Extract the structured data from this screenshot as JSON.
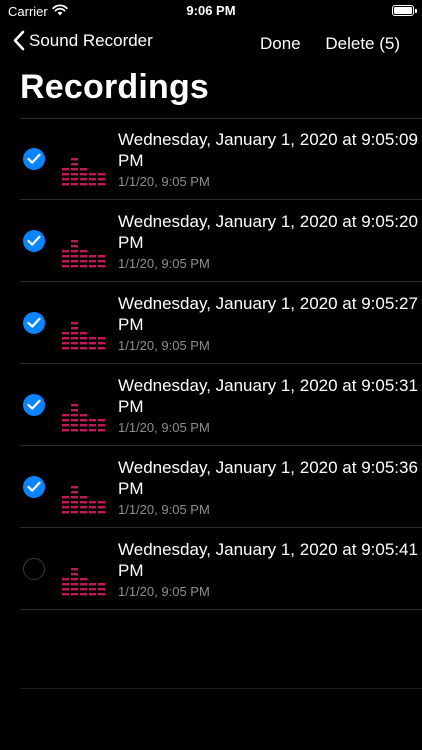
{
  "status": {
    "carrier": "Carrier",
    "time": "9:06 PM"
  },
  "nav": {
    "back_label": "Sound Recorder",
    "done_label": "Done",
    "delete_label": "Delete (5)"
  },
  "page": {
    "title": "Recordings"
  },
  "colors": {
    "accent": "#0a84ff",
    "wave": "#c2185b",
    "secondary_text": "#8e8e93"
  },
  "recordings": [
    {
      "title": "Wednesday, January 1, 2020 at 9:05:09 PM",
      "subtitle": "1/1/20, 9:05 PM",
      "selected": true
    },
    {
      "title": "Wednesday, January 1, 2020 at 9:05:20 PM",
      "subtitle": "1/1/20, 9:05 PM",
      "selected": true
    },
    {
      "title": "Wednesday, January 1, 2020 at 9:05:27 PM",
      "subtitle": "1/1/20, 9:05 PM",
      "selected": true
    },
    {
      "title": "Wednesday, January 1, 2020 at 9:05:31 PM",
      "subtitle": "1/1/20, 9:05 PM",
      "selected": true
    },
    {
      "title": "Wednesday, January 1, 2020 at 9:05:36 PM",
      "subtitle": "1/1/20, 9:05 PM",
      "selected": true
    },
    {
      "title": "Wednesday, January 1, 2020 at 9:05:41 PM",
      "subtitle": "1/1/20, 9:05 PM",
      "selected": false
    }
  ]
}
